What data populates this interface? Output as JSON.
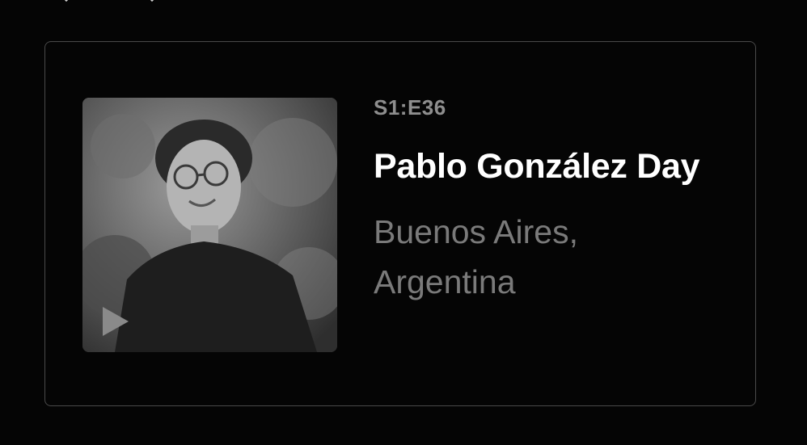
{
  "episode": {
    "code": "S1:E36",
    "guest_name": "Pablo González Day",
    "location": "Buenos Aires, Argentina",
    "play_icon": "play-icon"
  },
  "colors": {
    "background": "#050505",
    "border": "#4a4a4a",
    "title": "#ffffff",
    "subtitle": "#7a7a7a"
  }
}
